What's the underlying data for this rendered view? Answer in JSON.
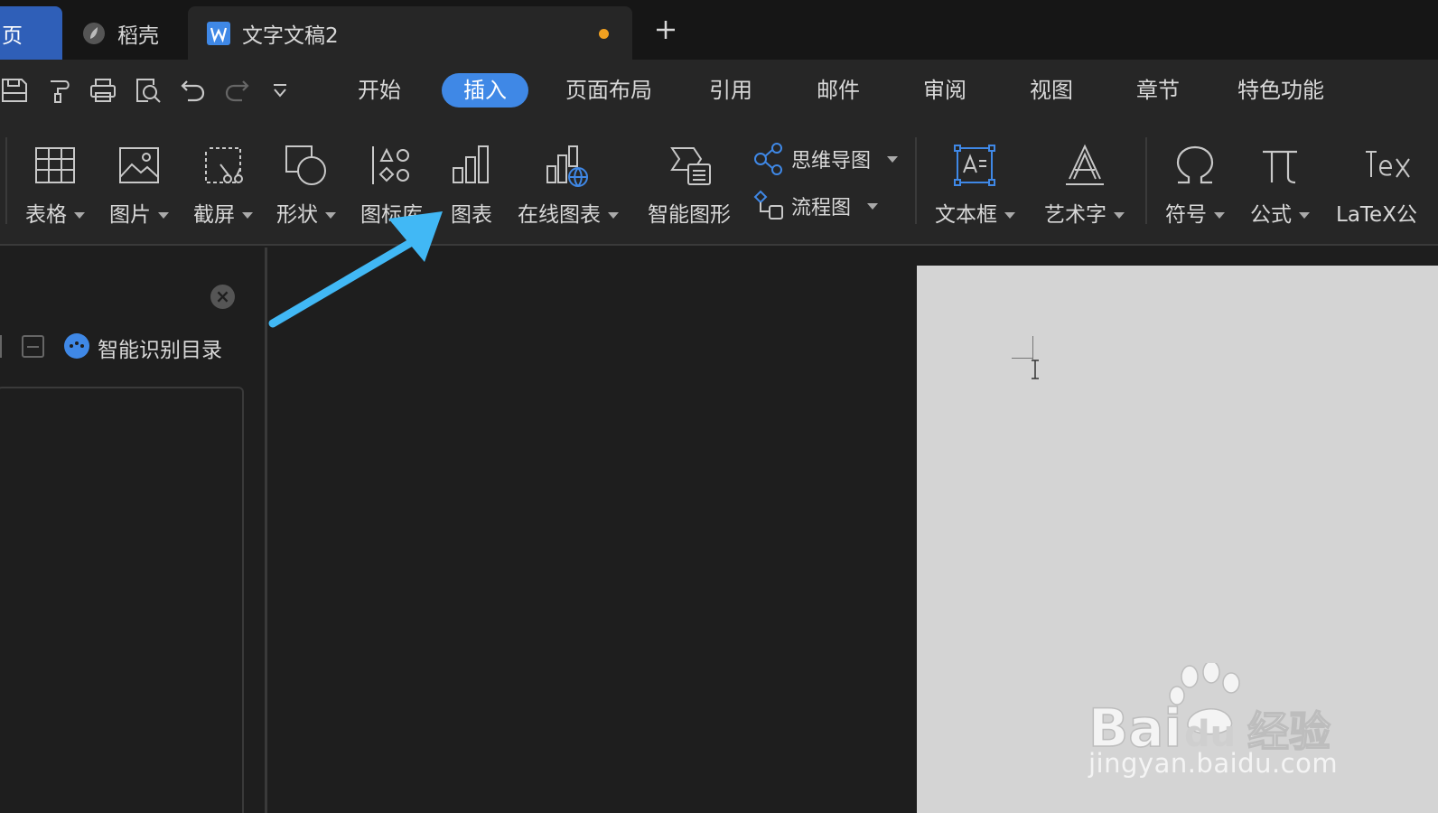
{
  "tabs": {
    "home": "页",
    "daoke": "稻壳",
    "doc": "文字文稿2"
  },
  "menu": {
    "items": [
      "开始",
      "插入",
      "页面布局",
      "引用",
      "邮件",
      "审阅",
      "视图",
      "章节",
      "特色功能"
    ],
    "active": "插入"
  },
  "ribbon": {
    "table": "表格",
    "picture": "图片",
    "screenshot": "截屏",
    "shape": "形状",
    "iconlib": "图标库",
    "chart": "图表",
    "online_chart": "在线图表",
    "smart_graphic": "智能图形",
    "mindmap": "思维导图",
    "flowchart": "流程图",
    "textbox": "文本框",
    "wordart": "艺术字",
    "symbol": "符号",
    "formula": "公式",
    "latex": "LaTeX公"
  },
  "nav_pane": {
    "toc_label": "智能识别目录"
  },
  "watermark": {
    "url": "jingyan.baidu.com"
  },
  "colors": {
    "accent": "#3f88e6",
    "arrow": "#41b8f5",
    "unsaved_dot": "#f0a020"
  }
}
